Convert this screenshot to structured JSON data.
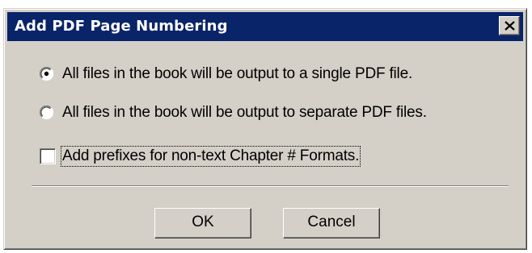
{
  "dialog": {
    "title": "Add PDF Page Numbering",
    "close_icon": "close-icon",
    "options": [
      {
        "label": "All files in the book will be output to a single PDF file.",
        "selected": true
      },
      {
        "label": "All files in the book will be output to separate PDF files.",
        "selected": false
      }
    ],
    "prefix_checkbox": {
      "label": "Add prefixes for non-text Chapter # Formats.",
      "checked": false
    },
    "buttons": {
      "ok_label": "OK",
      "cancel_label": "Cancel"
    }
  },
  "colors": {
    "title_bar": "#0a246a",
    "face": "#d4d0c8"
  }
}
